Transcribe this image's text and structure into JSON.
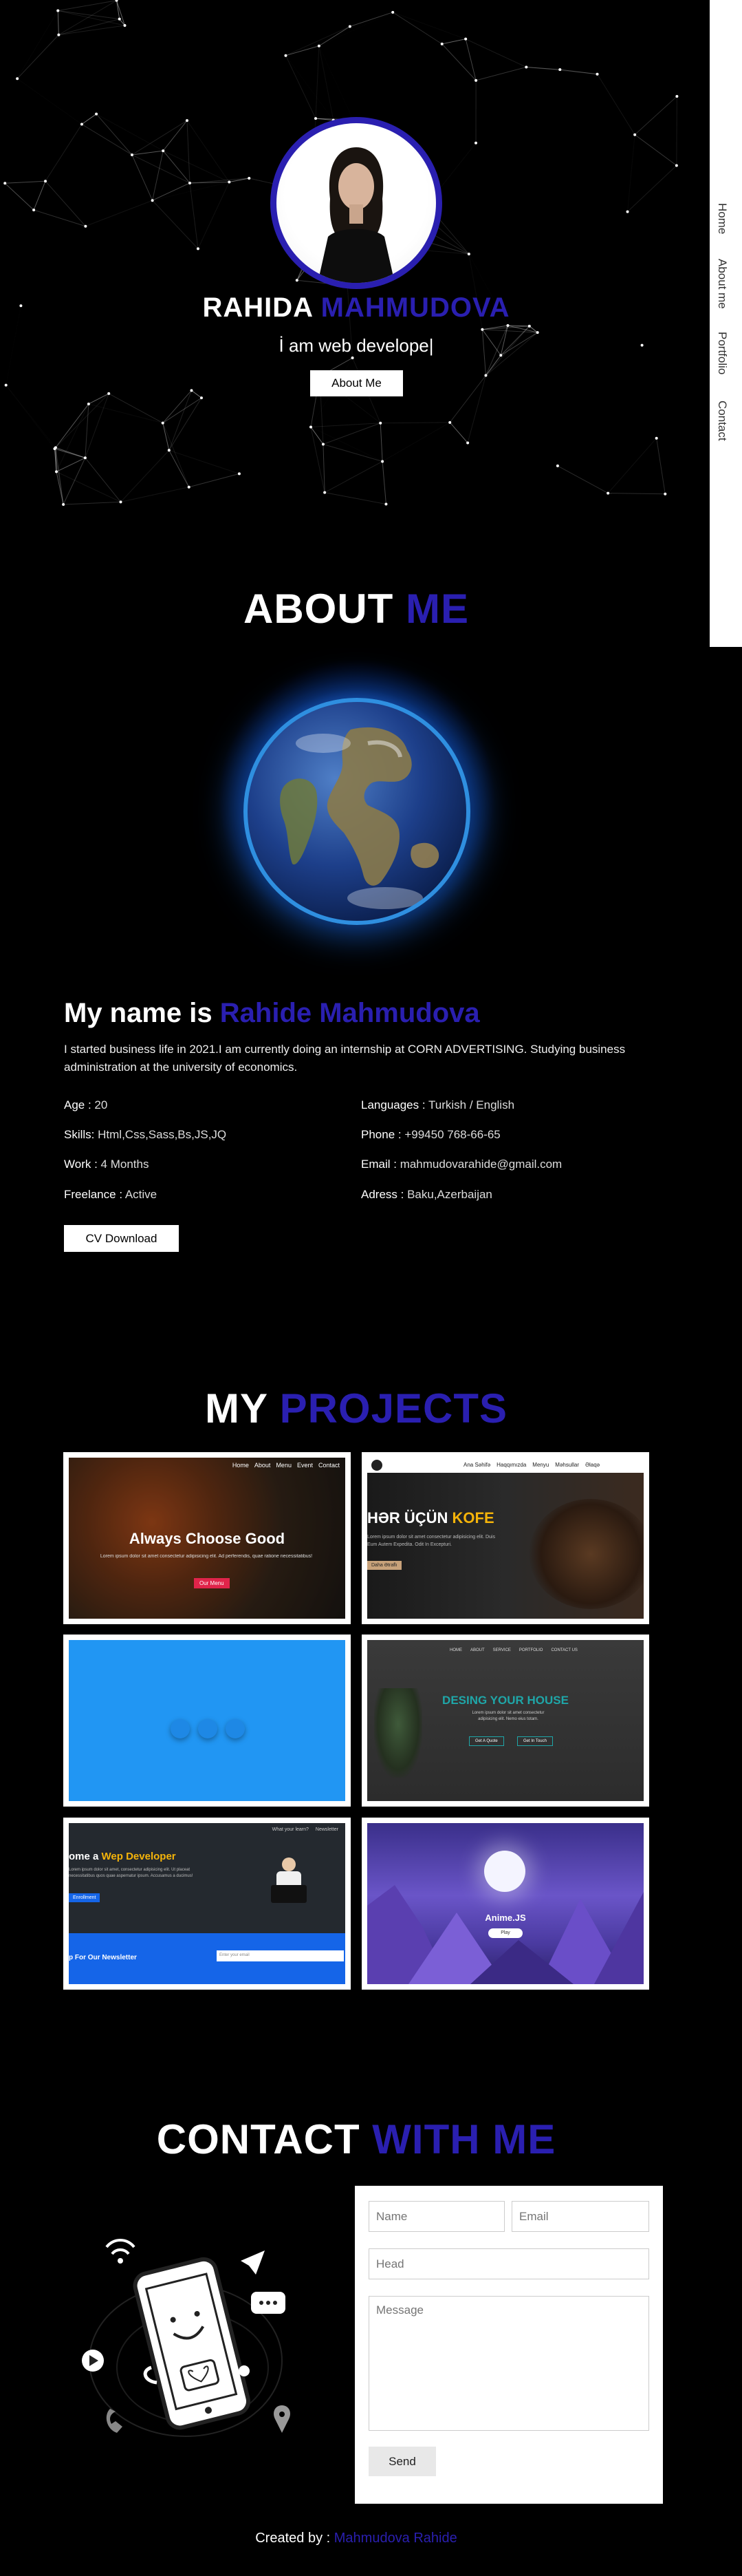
{
  "hero": {
    "first_name": "RAHIDA",
    "last_name": "MAHMUDOVA",
    "subtitle": "İ am web develope|",
    "button_label": "About Me"
  },
  "nav": {
    "items": [
      "Home",
      "About me",
      "Portfolio",
      "Contact"
    ]
  },
  "about": {
    "title_main": "ABOUT",
    "title_accent": "ME",
    "name_prefix": "My name is",
    "name": "Rahide Mahmudova",
    "description": "I started business life in 2021.I am currently doing an internship at CORN ADVERTISING. Studying business administration at the university of economics.",
    "left_info": [
      {
        "label": "Age :",
        "value": " 20"
      },
      {
        "label": "Skills:",
        "value": " Html,Css,Sass,Bs,JS,JQ"
      },
      {
        "label": "Work :",
        "value": " 4 Months"
      },
      {
        "label": "Freelance :",
        "value": " Active"
      }
    ],
    "right_info": [
      {
        "label": "Languages :",
        "value": " Turkish / English"
      },
      {
        "label": "Phone :",
        "value": " +99450 768-66-65"
      },
      {
        "label": "Email :",
        "value": " mahmudovarahide@gmail.com"
      },
      {
        "label": "Adress :",
        "value": " Baku,Azerbaijan"
      }
    ],
    "cv_label": "CV Download"
  },
  "projects": {
    "title_main": "MY",
    "title_accent": "PROJECTS",
    "p1": {
      "nav": [
        "Home",
        "About",
        "Menu",
        "Event",
        "Contact"
      ],
      "headline": "Always Choose Good",
      "text": "Lorem ipsum dolor sit amet consectetur adipisicing elit. Ad perferendis, quae ratione necessitatibus!",
      "button": "Our Menu"
    },
    "p2": {
      "brand": "KOFE",
      "nav": [
        "Ana Səhifə",
        "Haqqımızda",
        "Menyu",
        "Məhsullar",
        "Əlaqə"
      ],
      "headline_main": "HƏR ÜÇÜN",
      "headline_accent": "KOFE",
      "text": "Lorem ipsum dolor sit amet consectetur adipisicing elit. Duis Eum Autem Expedita. Odit In Excepturi.",
      "button": "Daha Ətraflı"
    },
    "p4": {
      "nav": [
        "HOME",
        "ABOUT",
        "SERVICE",
        "PORTFOLIO",
        "CONTACT US"
      ],
      "headline": "DESING YOUR HOUSE",
      "text": "Lorem ipsum dolor sit amet consectetur adipisicing elit. Nemo eius totam.",
      "btn1": "Get A Quote",
      "btn2": "Get In Touch"
    },
    "p5": {
      "nav": [
        "What your learn?",
        "Newsletter"
      ],
      "headline_main": "ome a",
      "headline_accent": "Wep Developer",
      "text": "Lorem ipsum dolor sit amet, consectetur adipisicing elit. Ut placeat necessitatibus quos quae aspernatur ipsum. Accusamus a ducimus!",
      "button": "Enrollment",
      "newsletter": "p For Our Newsletter",
      "placeholder": "Enter your email"
    },
    "p6": {
      "title": "Anime.JS",
      "button": "Play"
    }
  },
  "contact": {
    "title_main": "CONTACT",
    "title_accent": "WITH ME",
    "name_placeholder": "Name",
    "email_placeholder": "Email",
    "head_placeholder": "Head",
    "message_placeholder": "Message",
    "send_label": "Send"
  },
  "footer": {
    "prefix": "Created by :",
    "author": "Mahmudova Rahide"
  },
  "colors": {
    "accent": "#2a1fb0",
    "background": "#000000",
    "yellow": "#f5b40a",
    "teal": "#1fa6a8"
  }
}
